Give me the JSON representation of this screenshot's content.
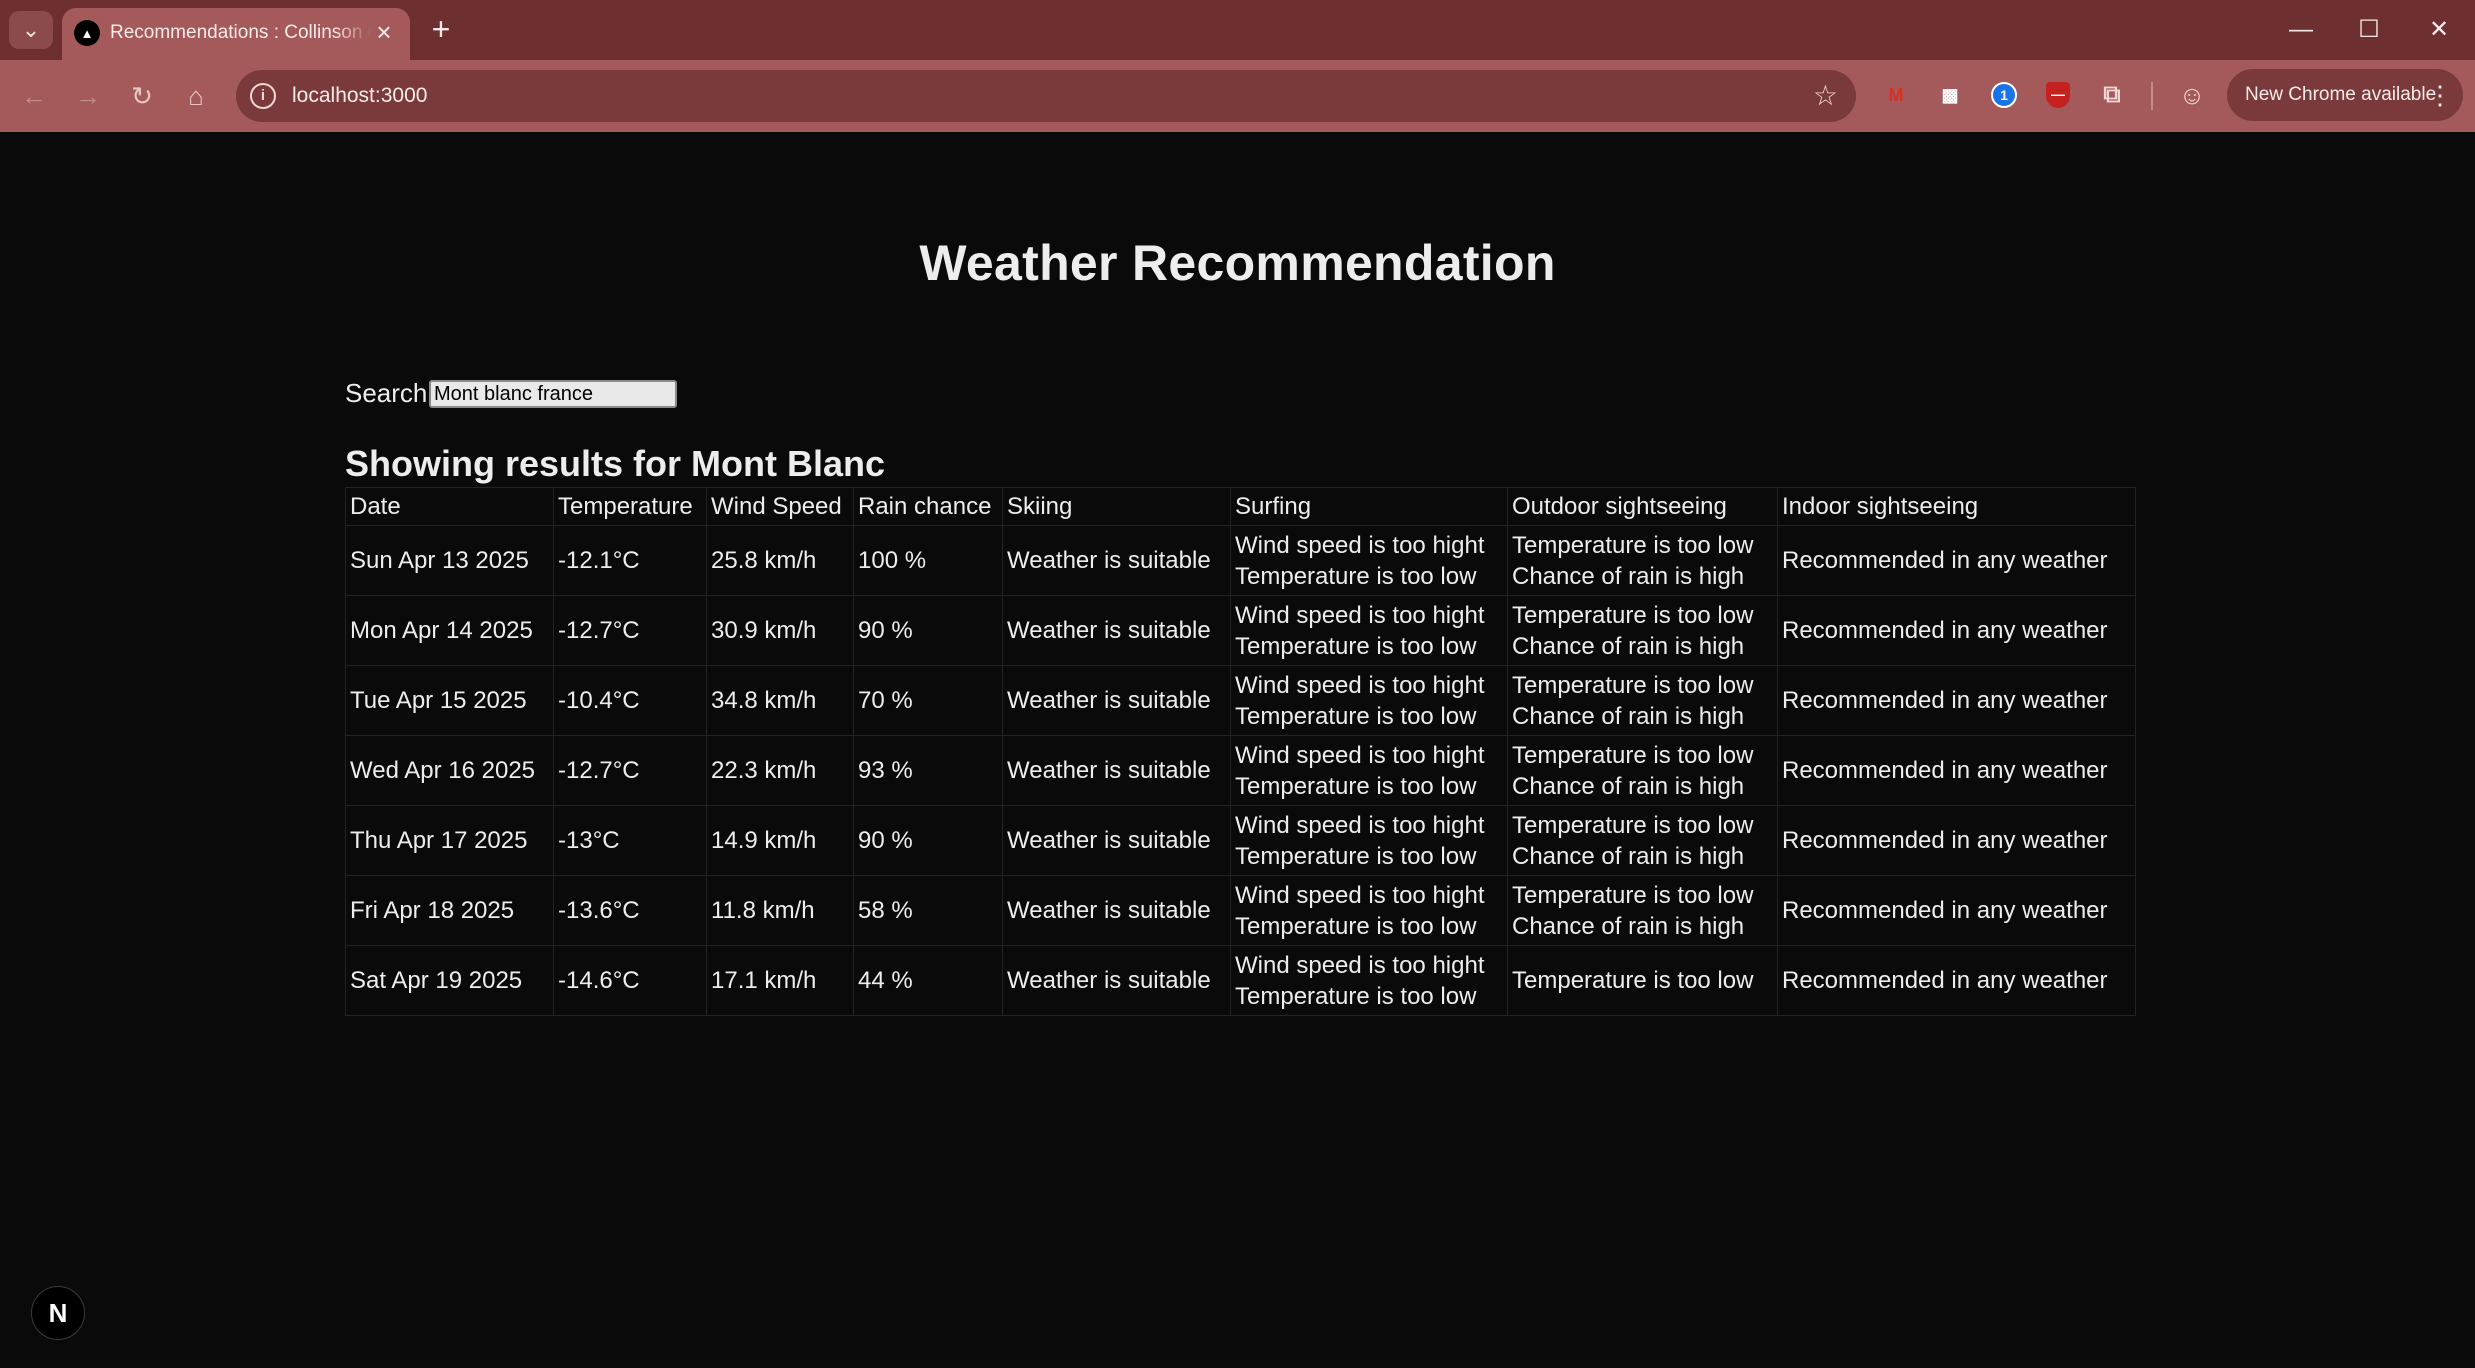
{
  "browser": {
    "tab_title": "Recommendations : Collinson g",
    "url": "localhost:3000",
    "update_label": "New Chrome available"
  },
  "page": {
    "heading": "Weather Recommendation",
    "search_label": "Search",
    "search_value": "Mont blanc france",
    "results_title": "Showing results for Mont Blanc"
  },
  "table": {
    "headers": [
      "Date",
      "Temperature",
      "Wind Speed",
      "Rain chance",
      "Skiing",
      "Surfing",
      "Outdoor sightseeing",
      "Indoor sightseeing"
    ],
    "rows": [
      {
        "date": "Sun Apr 13 2025",
        "temp": "-12.1°C",
        "wind": "25.8 km/h",
        "rain": "100 %",
        "skiing": "Weather is suitable",
        "surf1": "Wind speed is too hight",
        "surf2": "Temperature is too low",
        "out1": "Temperature is too low",
        "out2": "Chance of rain is high",
        "indoor": "Recommended in any weather"
      },
      {
        "date": "Mon Apr 14 2025",
        "temp": "-12.7°C",
        "wind": "30.9 km/h",
        "rain": "90 %",
        "skiing": "Weather is suitable",
        "surf1": "Wind speed is too hight",
        "surf2": "Temperature is too low",
        "out1": "Temperature is too low",
        "out2": "Chance of rain is high",
        "indoor": "Recommended in any weather"
      },
      {
        "date": "Tue Apr 15 2025",
        "temp": "-10.4°C",
        "wind": "34.8 km/h",
        "rain": "70 %",
        "skiing": "Weather is suitable",
        "surf1": "Wind speed is too hight",
        "surf2": "Temperature is too low",
        "out1": "Temperature is too low",
        "out2": "Chance of rain is high",
        "indoor": "Recommended in any weather"
      },
      {
        "date": "Wed Apr 16 2025",
        "temp": "-12.7°C",
        "wind": "22.3 km/h",
        "rain": "93 %",
        "skiing": "Weather is suitable",
        "surf1": "Wind speed is too hight",
        "surf2": "Temperature is too low",
        "out1": "Temperature is too low",
        "out2": "Chance of rain is high",
        "indoor": "Recommended in any weather"
      },
      {
        "date": "Thu Apr 17 2025",
        "temp": "-13°C",
        "wind": "14.9 km/h",
        "rain": "90 %",
        "skiing": "Weather is suitable",
        "surf1": "Wind speed is too hight",
        "surf2": "Temperature is too low",
        "out1": "Temperature is too low",
        "out2": "Chance of rain is high",
        "indoor": "Recommended in any weather"
      },
      {
        "date": "Fri Apr 18 2025",
        "temp": "-13.6°C",
        "wind": "11.8 km/h",
        "rain": "58 %",
        "skiing": "Weather is suitable",
        "surf1": "Wind speed is too hight",
        "surf2": "Temperature is too low",
        "out1": "Temperature is too low",
        "out2": "Chance of rain is high",
        "indoor": "Recommended in any weather"
      },
      {
        "date": "Sat Apr 19 2025",
        "temp": "-14.6°C",
        "wind": "17.1 km/h",
        "rain": "44 %",
        "skiing": "Weather is suitable",
        "surf1": "Wind speed is too hight",
        "surf2": "Temperature is too low",
        "out1": "Temperature is too low",
        "out2": "",
        "indoor": "Recommended in any weather"
      }
    ]
  },
  "colors": {
    "tab_strip": "#6e2f30",
    "toolbar": "#a4595a",
    "page_background": "#0a0a0a",
    "text": "#ededed"
  },
  "icons": {
    "nextjs_badge": "N"
  }
}
